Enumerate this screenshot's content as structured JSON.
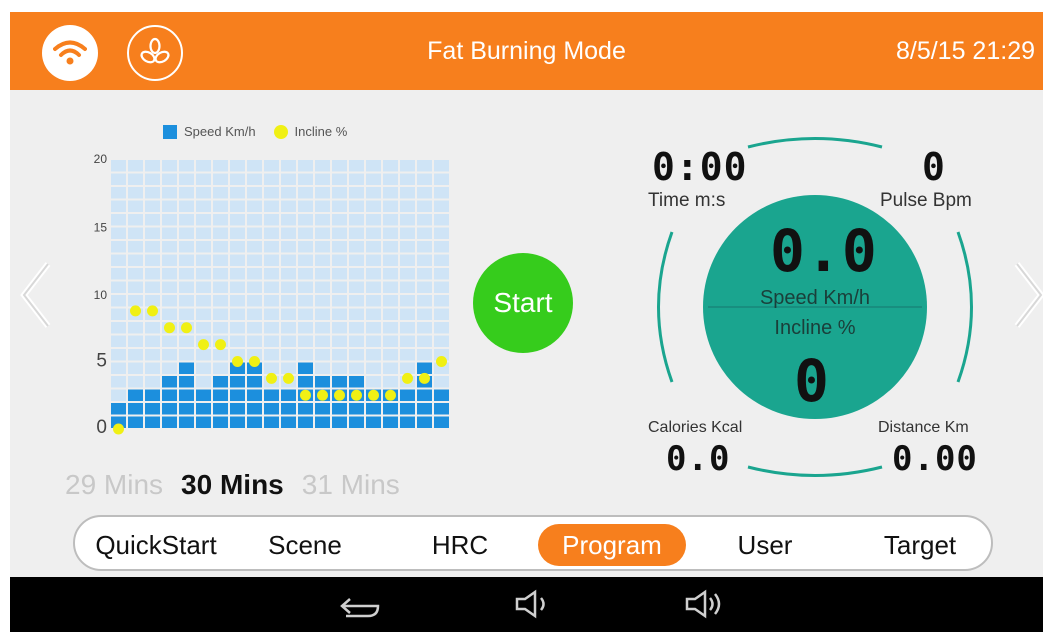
{
  "header": {
    "title": "Fat Burning Mode",
    "datetime": "8/5/15 21:29",
    "wifi_icon": "wifi-icon",
    "fan_icon": "fan-icon",
    "accent_color": "#f77f1d"
  },
  "chart_data": {
    "type": "bar",
    "legend": [
      "Speed Km/h",
      "Incline %"
    ],
    "ylim": [
      0,
      20
    ],
    "yticks": [
      "20",
      "15",
      "10",
      "5",
      "0"
    ],
    "series": [
      {
        "name": "Speed Km/h",
        "kind": "bar",
        "color": "#1c8fdd",
        "values": [
          2,
          3,
          3,
          4,
          5,
          3,
          4,
          5,
          5,
          3,
          3,
          5,
          4,
          4,
          4,
          3,
          3,
          3,
          5,
          3
        ]
      },
      {
        "name": "Incline %",
        "kind": "point",
        "color": "#f0f014",
        "values": [
          0,
          7,
          7,
          6,
          6,
          5,
          5,
          4,
          4,
          3,
          3,
          2,
          2,
          2,
          2,
          2,
          2,
          3,
          3,
          4
        ]
      }
    ],
    "grid_color": "#cfe4f6"
  },
  "time_selector": {
    "prev": "29 Mins",
    "current": "30 Mins",
    "next": "31 Mins"
  },
  "start_button": {
    "label": "Start"
  },
  "dashboard": {
    "time_value": "0:00",
    "time_label": "Time m:s",
    "pulse_value": "0",
    "pulse_label": "Pulse Bpm",
    "speed_value": "0.0",
    "speed_label": "Speed Km/h",
    "incline_label": "Incline %",
    "incline_value": "0",
    "calories_label": "Calories Kcal",
    "calories_value": "0.0",
    "distance_label": "Distance Km",
    "distance_value": "0.00",
    "circle_color": "#1aa58f"
  },
  "tabs": [
    {
      "label": "QuickStart",
      "active": false
    },
    {
      "label": "Scene",
      "active": false
    },
    {
      "label": "HRC",
      "active": false
    },
    {
      "label": "Program",
      "active": true
    },
    {
      "label": "User",
      "active": false
    },
    {
      "label": "Target",
      "active": false
    }
  ],
  "nav": {
    "prev_icon": "chevron-left-icon",
    "next_icon": "chevron-right-icon"
  },
  "system_bar": {
    "back_icon": "back-icon",
    "vol_down_icon": "volume-down-icon",
    "vol_up_icon": "volume-up-icon"
  }
}
